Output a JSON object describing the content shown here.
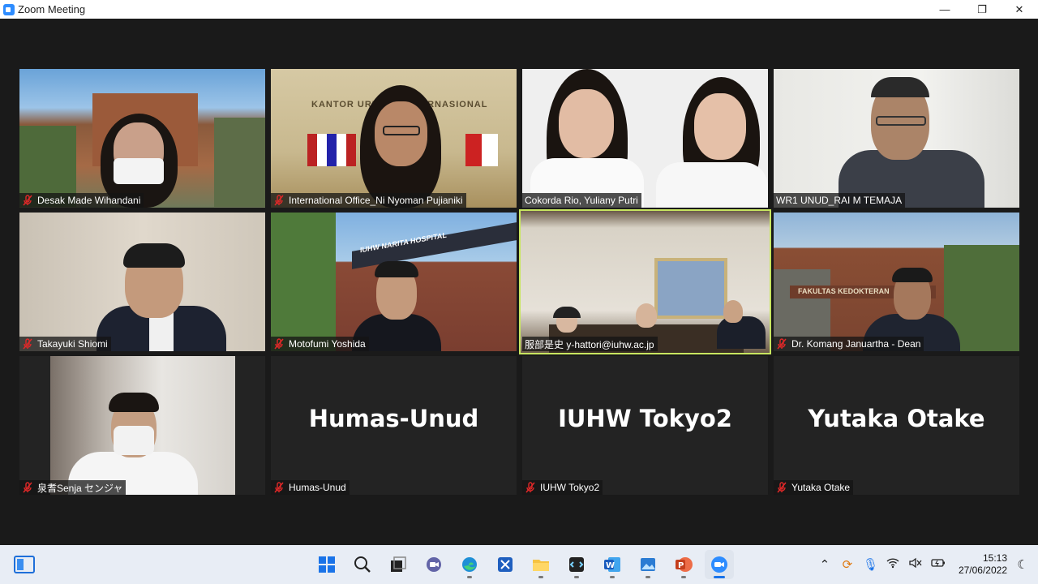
{
  "window": {
    "title": "Zoom Meeting",
    "controls": {
      "minimize": "—",
      "restore": "❐",
      "close": "✕"
    }
  },
  "participants": [
    {
      "name": "Desak Made Wihandani",
      "muted": true,
      "video": true
    },
    {
      "name": "International Office_Ni Nyoman Pujianiki",
      "muted": true,
      "video": true,
      "background_text": "KANTOR URUSAN INTERNASIONAL"
    },
    {
      "name": "Cokorda Rio, Yuliany Putri",
      "muted": false,
      "video": true
    },
    {
      "name": "WR1 UNUD_RAI M TEMAJA",
      "muted": false,
      "video": true
    },
    {
      "name": "Takayuki Shiomi",
      "muted": true,
      "video": true
    },
    {
      "name": "Motofumi Yoshida",
      "muted": true,
      "video": true,
      "background_text": "IUHW NARITA HOSPITAL"
    },
    {
      "name": "服部是史 y-hattori@iuhw.ac.jp",
      "muted": false,
      "video": true,
      "active_speaker": true
    },
    {
      "name": "Dr. Komang Januartha - Dean",
      "muted": true,
      "video": true,
      "background_text": "FAKULTAS KEDOKTERAN"
    },
    {
      "name": "泉耆Senja センジャ",
      "muted": true,
      "video": true
    },
    {
      "name": "Humas-Unud",
      "muted": true,
      "video": false,
      "display": "Humas-Unud"
    },
    {
      "name": "IUHW Tokyo2",
      "muted": true,
      "video": false,
      "display": "IUHW Tokyo2"
    },
    {
      "name": "Yutaka Otake",
      "muted": true,
      "video": false,
      "display": "Yutaka Otake"
    }
  ],
  "taskbar": {
    "apps": [
      "windows-start",
      "search",
      "task-view",
      "teams-chat",
      "edge",
      "snipping",
      "file-explorer",
      "vscode",
      "word",
      "photos",
      "powerpoint",
      "zoom"
    ],
    "tray": {
      "time": "15:13",
      "date": "27/06/2022"
    }
  },
  "colors": {
    "active_speaker": "#c8e660",
    "muted_mic": "#e02828",
    "zoom_blue": "#2D8CFF"
  }
}
